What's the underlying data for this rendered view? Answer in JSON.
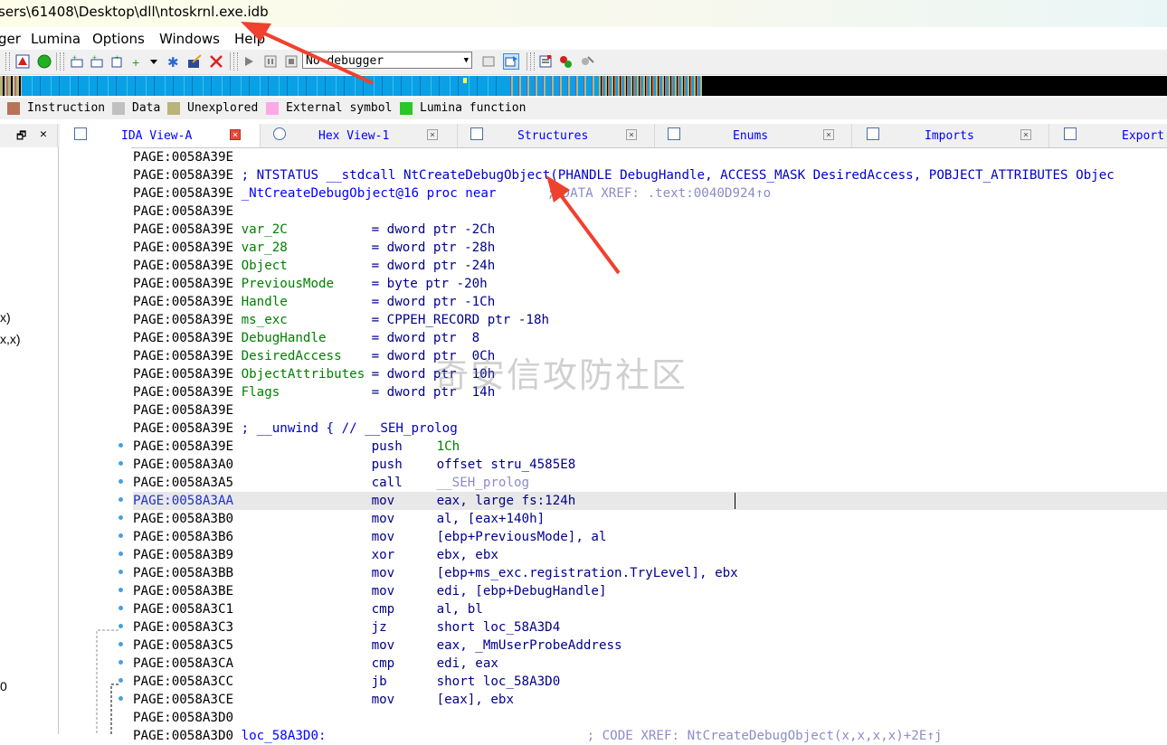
{
  "window": {
    "title": "sers\\61408\\Desktop\\dll\\ntoskrnl.exe.idb"
  },
  "menu": [
    "ger",
    "Lumina",
    "Options",
    "Windows",
    "Help"
  ],
  "toolbar": {
    "debugger_select": "No debugger"
  },
  "legend": [
    {
      "label": "Instruction",
      "color": "#b67358"
    },
    {
      "label": "Data",
      "color": "#c0c0c0"
    },
    {
      "label": "Unexplored",
      "color": "#b8b47a"
    },
    {
      "label": "External symbol",
      "color": "#ffa8e8"
    },
    {
      "label": "Lumina function",
      "color": "#28c828"
    }
  ],
  "tabs": [
    {
      "label": "IDA View-A",
      "active": true
    },
    {
      "label": "Hex View-1",
      "active": false
    },
    {
      "label": "Structures",
      "active": false
    },
    {
      "label": "Enums",
      "active": false
    },
    {
      "label": "Imports",
      "active": false
    },
    {
      "label": "Export",
      "active": false
    }
  ],
  "left_pane": {
    "items": [
      "x)",
      "x,x)",
      "0"
    ]
  },
  "code": [
    {
      "addr": "PAGE:0058A39E",
      "text": ""
    },
    {
      "addr": "PAGE:0058A39E",
      "text": "; NTSTATUS __stdcall NtCreateDebugObject(PHANDLE DebugHandle, ACCESS_MASK DesiredAccess, POBJECT_ATTRIBUTES Objec"
    },
    {
      "addr": "PAGE:0058A39E",
      "text": "_NtCreateDebugObject@16 proc near",
      "xref": "; DATA XREF: .text:0040D924↑o"
    },
    {
      "addr": "PAGE:0058A39E",
      "text": ""
    },
    {
      "addr": "PAGE:0058A39E",
      "var": "var_2C",
      "def": "= dword ptr -2Ch"
    },
    {
      "addr": "PAGE:0058A39E",
      "var": "var_28",
      "def": "= dword ptr -28h"
    },
    {
      "addr": "PAGE:0058A39E",
      "var": "Object",
      "def": "= dword ptr -24h"
    },
    {
      "addr": "PAGE:0058A39E",
      "var": "PreviousMode",
      "def": "= byte ptr -20h"
    },
    {
      "addr": "PAGE:0058A39E",
      "var": "Handle",
      "def": "= dword ptr -1Ch"
    },
    {
      "addr": "PAGE:0058A39E",
      "var": "ms_exc",
      "def": "= CPPEH_RECORD ptr -18h"
    },
    {
      "addr": "PAGE:0058A39E",
      "var": "DebugHandle",
      "def": "= dword ptr  8"
    },
    {
      "addr": "PAGE:0058A39E",
      "var": "DesiredAccess",
      "def": "= dword ptr  0Ch"
    },
    {
      "addr": "PAGE:0058A39E",
      "var": "ObjectAttributes",
      "def": "= dword ptr  10h"
    },
    {
      "addr": "PAGE:0058A39E",
      "var": "Flags",
      "def": "= dword ptr  14h"
    },
    {
      "addr": "PAGE:0058A39E",
      "text": ""
    },
    {
      "addr": "PAGE:0058A39E",
      "text": "; __unwind { // __SEH_prolog"
    },
    {
      "addr": "PAGE:0058A39E",
      "mnem": "push",
      "ops": "1Ch"
    },
    {
      "addr": "PAGE:0058A3A0",
      "mnem": "push",
      "ops": "offset stru_4585E8"
    },
    {
      "addr": "PAGE:0058A3A5",
      "mnem": "call",
      "ops": "__SEH_prolog"
    },
    {
      "addr": "PAGE:0058A3AA",
      "mnem": "mov",
      "ops": "eax, large fs:124h",
      "highlight": true
    },
    {
      "addr": "PAGE:0058A3B0",
      "mnem": "mov",
      "ops": "al, [eax+140h]"
    },
    {
      "addr": "PAGE:0058A3B6",
      "mnem": "mov",
      "ops": "[ebp+PreviousMode], al"
    },
    {
      "addr": "PAGE:0058A3B9",
      "mnem": "xor",
      "ops": "ebx, ebx"
    },
    {
      "addr": "PAGE:0058A3BB",
      "mnem": "mov",
      "ops": "[ebp+ms_exc.registration.TryLevel], ebx"
    },
    {
      "addr": "PAGE:0058A3BE",
      "mnem": "mov",
      "ops": "edi, [ebp+DebugHandle]"
    },
    {
      "addr": "PAGE:0058A3C1",
      "mnem": "cmp",
      "ops": "al, bl"
    },
    {
      "addr": "PAGE:0058A3C3",
      "mnem": "jz",
      "ops": "short loc_58A3D4"
    },
    {
      "addr": "PAGE:0058A3C5",
      "mnem": "mov",
      "ops": "eax, _MmUserProbeAddress"
    },
    {
      "addr": "PAGE:0058A3CA",
      "mnem": "cmp",
      "ops": "edi, eax"
    },
    {
      "addr": "PAGE:0058A3CC",
      "mnem": "jb",
      "ops": "short loc_58A3D0"
    },
    {
      "addr": "PAGE:0058A3CE",
      "mnem": "mov",
      "ops": "[eax], ebx"
    },
    {
      "addr": "PAGE:0058A3D0",
      "text": ""
    },
    {
      "addr": "PAGE:0058A3D0",
      "text": "loc_58A3D0:",
      "xref": "; CODE XREF: NtCreateDebugObject(x,x,x,x)+2E↑j"
    }
  ],
  "watermark": "奇安信攻防社区"
}
